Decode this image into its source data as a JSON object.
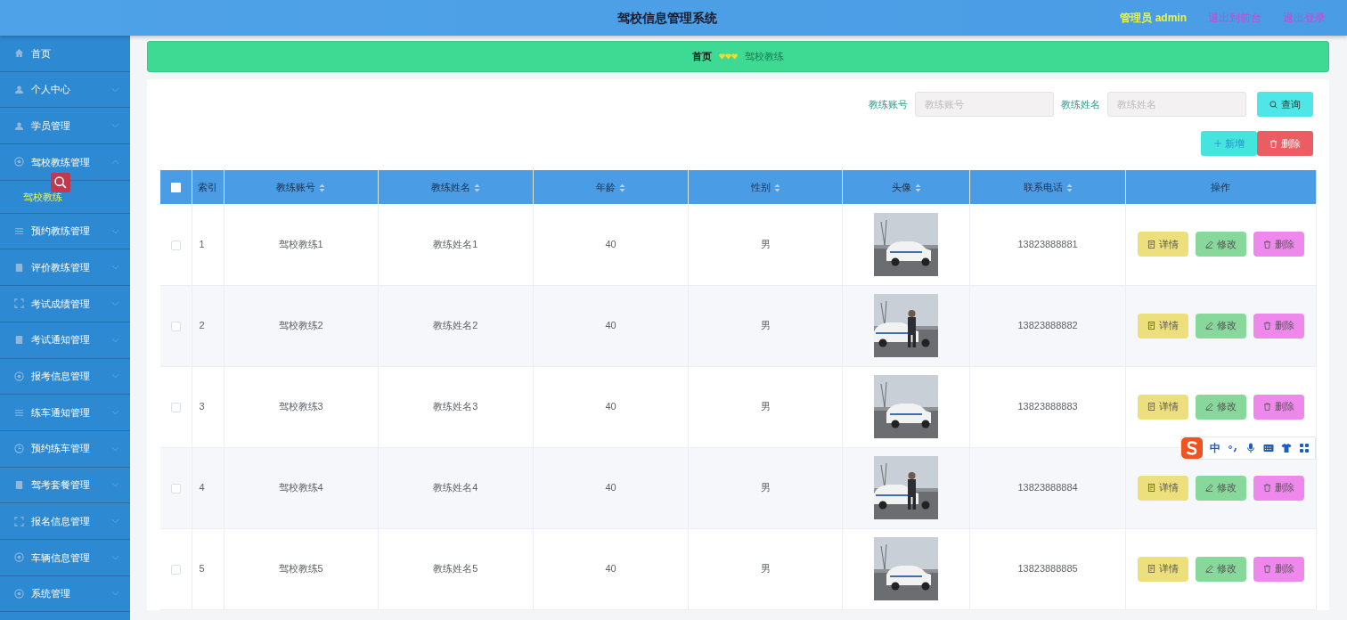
{
  "header": {
    "title": "驾校信息管理系统",
    "user": "管理员 admin",
    "links": [
      "退出到前台",
      "退出登录"
    ]
  },
  "sidebar": {
    "items": [
      {
        "label": "首页",
        "kind": "link"
      },
      {
        "label": "个人中心",
        "kind": "menu",
        "expanded": false
      },
      {
        "label": "学员管理",
        "kind": "menu",
        "expanded": false
      },
      {
        "label": "驾校教练管理",
        "kind": "menu",
        "expanded": true,
        "children": [
          {
            "label": "驾校教练",
            "selected": true
          }
        ]
      },
      {
        "label": "预约教练管理",
        "kind": "menu",
        "expanded": false
      },
      {
        "label": "评价教练管理",
        "kind": "menu",
        "expanded": false
      },
      {
        "label": "考试成绩管理",
        "kind": "menu",
        "expanded": false
      },
      {
        "label": "考试通知管理",
        "kind": "menu",
        "expanded": false
      },
      {
        "label": "报考信息管理",
        "kind": "menu",
        "expanded": false
      },
      {
        "label": "练车通知管理",
        "kind": "menu",
        "expanded": false
      },
      {
        "label": "预约练车管理",
        "kind": "menu",
        "expanded": false
      },
      {
        "label": "驾考套餐管理",
        "kind": "menu",
        "expanded": false
      },
      {
        "label": "报名信息管理",
        "kind": "menu",
        "expanded": false
      },
      {
        "label": "车辆信息管理",
        "kind": "menu",
        "expanded": false
      },
      {
        "label": "系统管理",
        "kind": "menu",
        "expanded": false
      }
    ]
  },
  "breadcrumb": [
    {
      "label": "首页",
      "active": true
    },
    {
      "label": "驾校教练",
      "active": false
    }
  ],
  "search": {
    "fields": [
      {
        "label": "教练账号",
        "placeholder": "教练账号"
      },
      {
        "label": "教练姓名",
        "placeholder": "教练姓名"
      }
    ],
    "button": "查询"
  },
  "actions": [
    {
      "label": "新增",
      "kind": "add"
    },
    {
      "label": "删除",
      "kind": "delete"
    }
  ],
  "table": {
    "select_all": false,
    "columns": [
      {
        "label": "索引",
        "sortable": false
      },
      {
        "label": "教练账号",
        "sortable": true
      },
      {
        "label": "教练姓名",
        "sortable": true
      },
      {
        "label": "年龄",
        "sortable": true
      },
      {
        "label": "性别",
        "sortable": true
      },
      {
        "label": "头像",
        "sortable": true
      },
      {
        "label": "联系电话",
        "sortable": true
      },
      {
        "label": "操作",
        "sortable": false
      }
    ],
    "rows": [
      {
        "checked": false,
        "index": "1",
        "account": "驾校教练1",
        "name": "教练姓名1",
        "age": "40",
        "gender": "男",
        "phone": "13823888881",
        "actions": [
          {
            "label": "详情",
            "kind": "detail"
          },
          {
            "label": "修改",
            "kind": "edit"
          },
          {
            "label": "删除",
            "kind": "delete"
          }
        ]
      },
      {
        "checked": false,
        "index": "2",
        "account": "驾校教练2",
        "name": "教练姓名2",
        "age": "40",
        "gender": "男",
        "phone": "13823888882",
        "actions": [
          {
            "label": "详情",
            "kind": "detail"
          },
          {
            "label": "修改",
            "kind": "edit"
          },
          {
            "label": "删除",
            "kind": "delete"
          }
        ]
      },
      {
        "checked": false,
        "index": "3",
        "account": "驾校教练3",
        "name": "教练姓名3",
        "age": "40",
        "gender": "男",
        "phone": "13823888883",
        "actions": [
          {
            "label": "详情",
            "kind": "detail"
          },
          {
            "label": "修改",
            "kind": "edit"
          },
          {
            "label": "删除",
            "kind": "delete"
          }
        ]
      },
      {
        "checked": false,
        "index": "4",
        "account": "驾校教练4",
        "name": "教练姓名4",
        "age": "40",
        "gender": "男",
        "phone": "13823888884",
        "actions": [
          {
            "label": "详情",
            "kind": "detail"
          },
          {
            "label": "修改",
            "kind": "edit"
          },
          {
            "label": "删除",
            "kind": "delete"
          }
        ]
      },
      {
        "checked": false,
        "index": "5",
        "account": "驾校教练5",
        "name": "教练姓名5",
        "age": "40",
        "gender": "男",
        "phone": "13823888885",
        "actions": [
          {
            "label": "详情",
            "kind": "detail"
          },
          {
            "label": "修改",
            "kind": "edit"
          },
          {
            "label": "删除",
            "kind": "delete"
          }
        ]
      }
    ]
  },
  "ime_toolbar": {
    "label": "中"
  }
}
